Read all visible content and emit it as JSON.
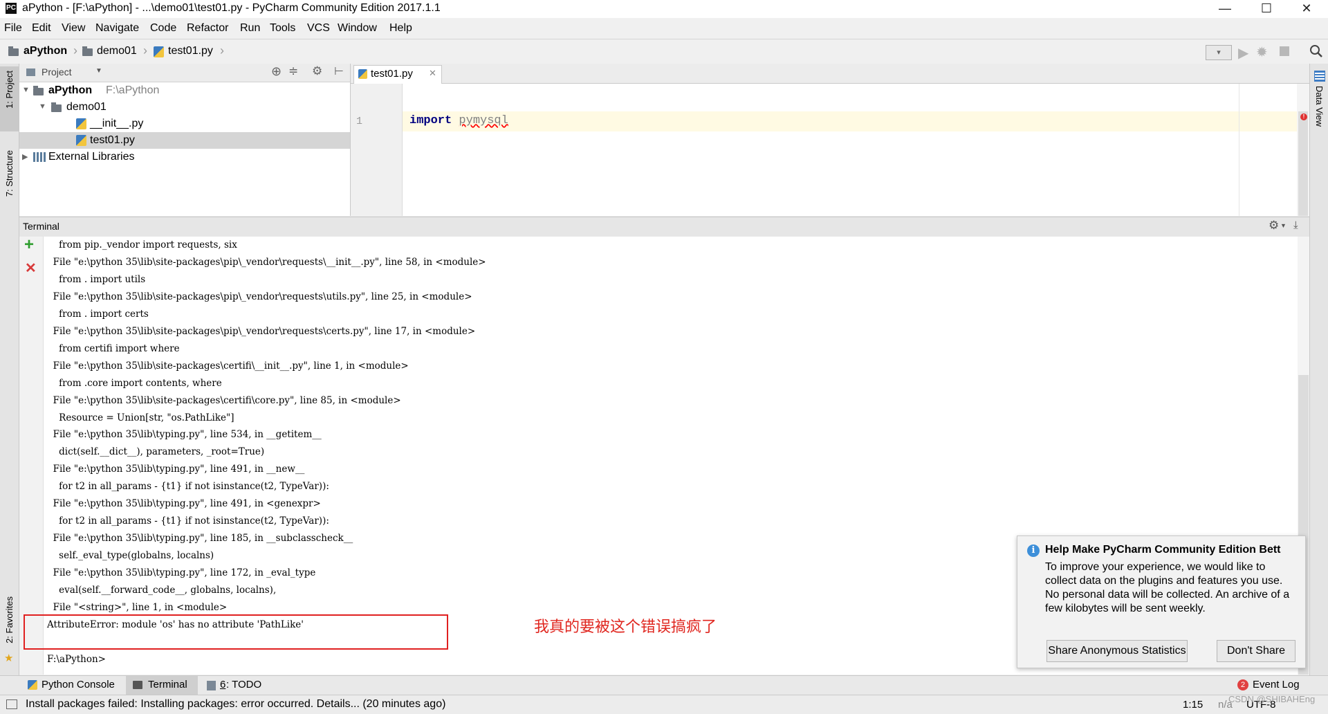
{
  "window": {
    "title": "aPython - [F:\\aPython] - ...\\demo01\\test01.py - PyCharm Community Edition 2017.1.1",
    "app_icon_label": "PC",
    "minimize": "—",
    "maximize": "☐",
    "close": "✕"
  },
  "menu": [
    "File",
    "Edit",
    "View",
    "Navigate",
    "Code",
    "Refactor",
    "Run",
    "Tools",
    "VCS",
    "Window",
    "Help"
  ],
  "breadcrumb": [
    "aPython",
    "demo01",
    "test01.py"
  ],
  "left_strip": {
    "project_tab": "1: Project",
    "structure_tab": "7: Structure",
    "favorites_tab": "2: Favorites"
  },
  "right_strip": {
    "data_view_tab": "Data View"
  },
  "project_panel": {
    "header": "Project",
    "tree": [
      {
        "label": "aPython",
        "hint": "F:\\aPython"
      },
      {
        "label": "demo01",
        "hint": ""
      },
      {
        "label": "__init__.py",
        "hint": ""
      },
      {
        "label": "test01.py",
        "hint": ""
      },
      {
        "label": "External Libraries",
        "hint": ""
      }
    ]
  },
  "editor": {
    "tab": "test01.py",
    "line_number": "1",
    "keyword": "import",
    "module": "pymysql"
  },
  "terminal": {
    "title": "Terminal",
    "lines": [
      "    from pip._vendor import requests, six",
      "  File \"e:\\python 35\\lib\\site-packages\\pip\\_vendor\\requests\\__init__.py\", line 58, in <module>",
      "    from . import utils",
      "  File \"e:\\python 35\\lib\\site-packages\\pip\\_vendor\\requests\\utils.py\", line 25, in <module>",
      "    from . import certs",
      "  File \"e:\\python 35\\lib\\site-packages\\pip\\_vendor\\requests\\certs.py\", line 17, in <module>",
      "    from certifi import where",
      "  File \"e:\\python 35\\lib\\site-packages\\certifi\\__init__.py\", line 1, in <module>",
      "    from .core import contents, where",
      "  File \"e:\\python 35\\lib\\site-packages\\certifi\\core.py\", line 85, in <module>",
      "    Resource = Union[str, \"os.PathLike\"]",
      "  File \"e:\\python 35\\lib\\typing.py\", line 534, in __getitem__",
      "    dict(self.__dict__), parameters, _root=True)",
      "  File \"e:\\python 35\\lib\\typing.py\", line 491, in __new__",
      "    for t2 in all_params - {t1} if not isinstance(t2, TypeVar)):",
      "  File \"e:\\python 35\\lib\\typing.py\", line 491, in <genexpr>",
      "    for t2 in all_params - {t1} if not isinstance(t2, TypeVar)):",
      "  File \"e:\\python 35\\lib\\typing.py\", line 185, in __subclasscheck__",
      "    self._eval_type(globalns, localns)",
      "  File \"e:\\python 35\\lib\\typing.py\", line 172, in _eval_type",
      "    eval(self.__forward_code__, globalns, localns),",
      "  File \"<string>\", line 1, in <module>",
      "AttributeError: module 'os' has no attribute 'PathLike'",
      "",
      "F:\\aPython>"
    ],
    "annotation": "我真的要被这个错误搞疯了"
  },
  "notification": {
    "title": "Help Make PyCharm Community Edition Bett",
    "body": "To improve your experience, we would like to collect data on the plugins and features you use. No personal data will be collected. An archive of a few kilobytes will be sent weekly.",
    "share_button": "Share Anonymous Statistics",
    "dont_share_button": "Don't Share"
  },
  "bottom_tabs": {
    "python_console": "Python Console",
    "terminal": "Terminal",
    "todo_number": "6",
    "todo_label": ": TODO",
    "event_log": "Event Log",
    "event_count": "2"
  },
  "status": {
    "message": "Install packages failed: Installing packages: error occurred. Details... (20 minutes ago)",
    "position": "1:15",
    "separator": "n/a",
    "encoding": "UTF-8",
    "watermark": "CSDN @SHIBAHEng"
  },
  "colors": {
    "annotation": "#e0261f",
    "highlight_box": "#e02020",
    "caret_line": "#fffae3",
    "keyword": "#000080"
  }
}
